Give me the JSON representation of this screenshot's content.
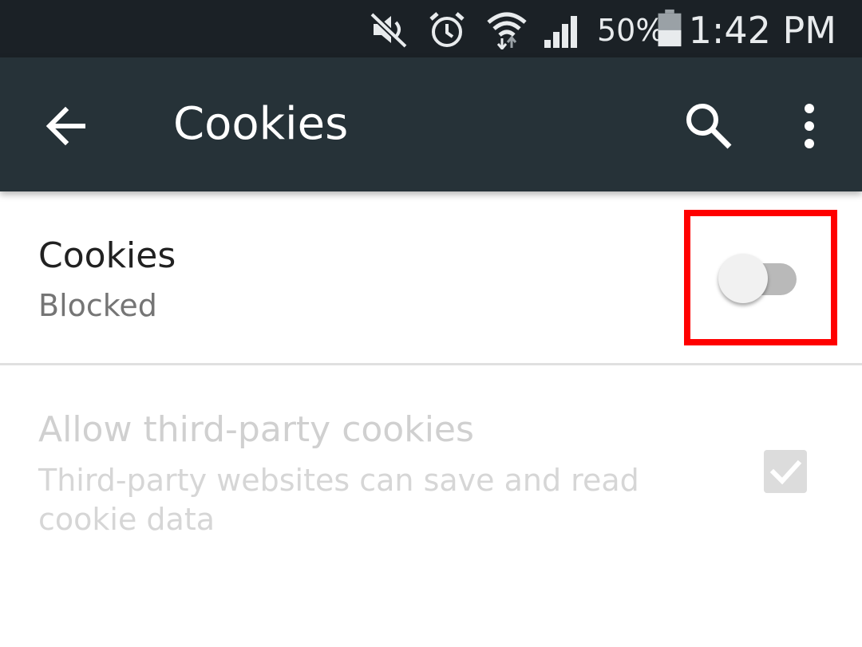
{
  "status_bar": {
    "battery_percent": "50%",
    "time": "1:42 PM",
    "icons": [
      "mute-icon",
      "alarm-icon",
      "wifi-icon",
      "signal-icon",
      "battery-icon"
    ]
  },
  "app_bar": {
    "title": "Cookies",
    "back_icon": "arrow-back-icon",
    "search_icon": "search-icon",
    "more_icon": "more-vert-icon",
    "background_color": "#263238"
  },
  "settings": {
    "cookies": {
      "title": "Cookies",
      "summary": "Blocked",
      "enabled": false
    },
    "third_party": {
      "title": "Allow third-party cookies",
      "summary_line1": "Third-party websites can save and read",
      "summary_line2": "cookie data",
      "checked": true,
      "disabled": true
    }
  },
  "highlight_color": "#ff0000"
}
